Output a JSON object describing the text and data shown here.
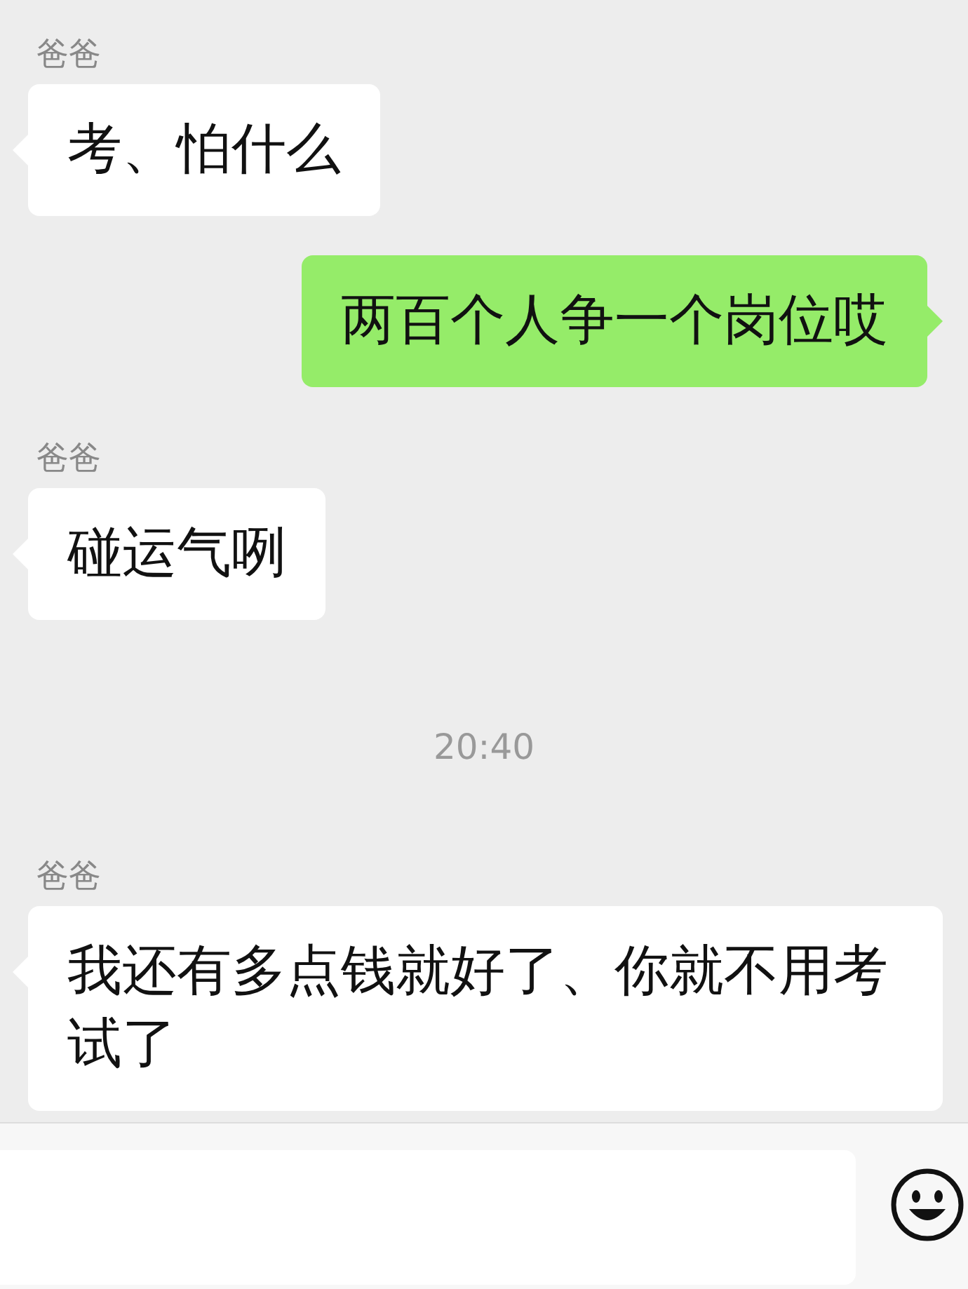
{
  "messages": [
    {
      "kind": "received",
      "sender": "爸爸",
      "text": "考、怕什么"
    },
    {
      "kind": "sent",
      "text": "两百个人争一个岗位哎"
    },
    {
      "kind": "received",
      "sender": "爸爸",
      "text": "碰运气咧"
    },
    {
      "kind": "time",
      "text": "20:40"
    },
    {
      "kind": "received",
      "sender": "爸爸",
      "text": "我还有多点钱就好了、你就不用考试了"
    }
  ]
}
